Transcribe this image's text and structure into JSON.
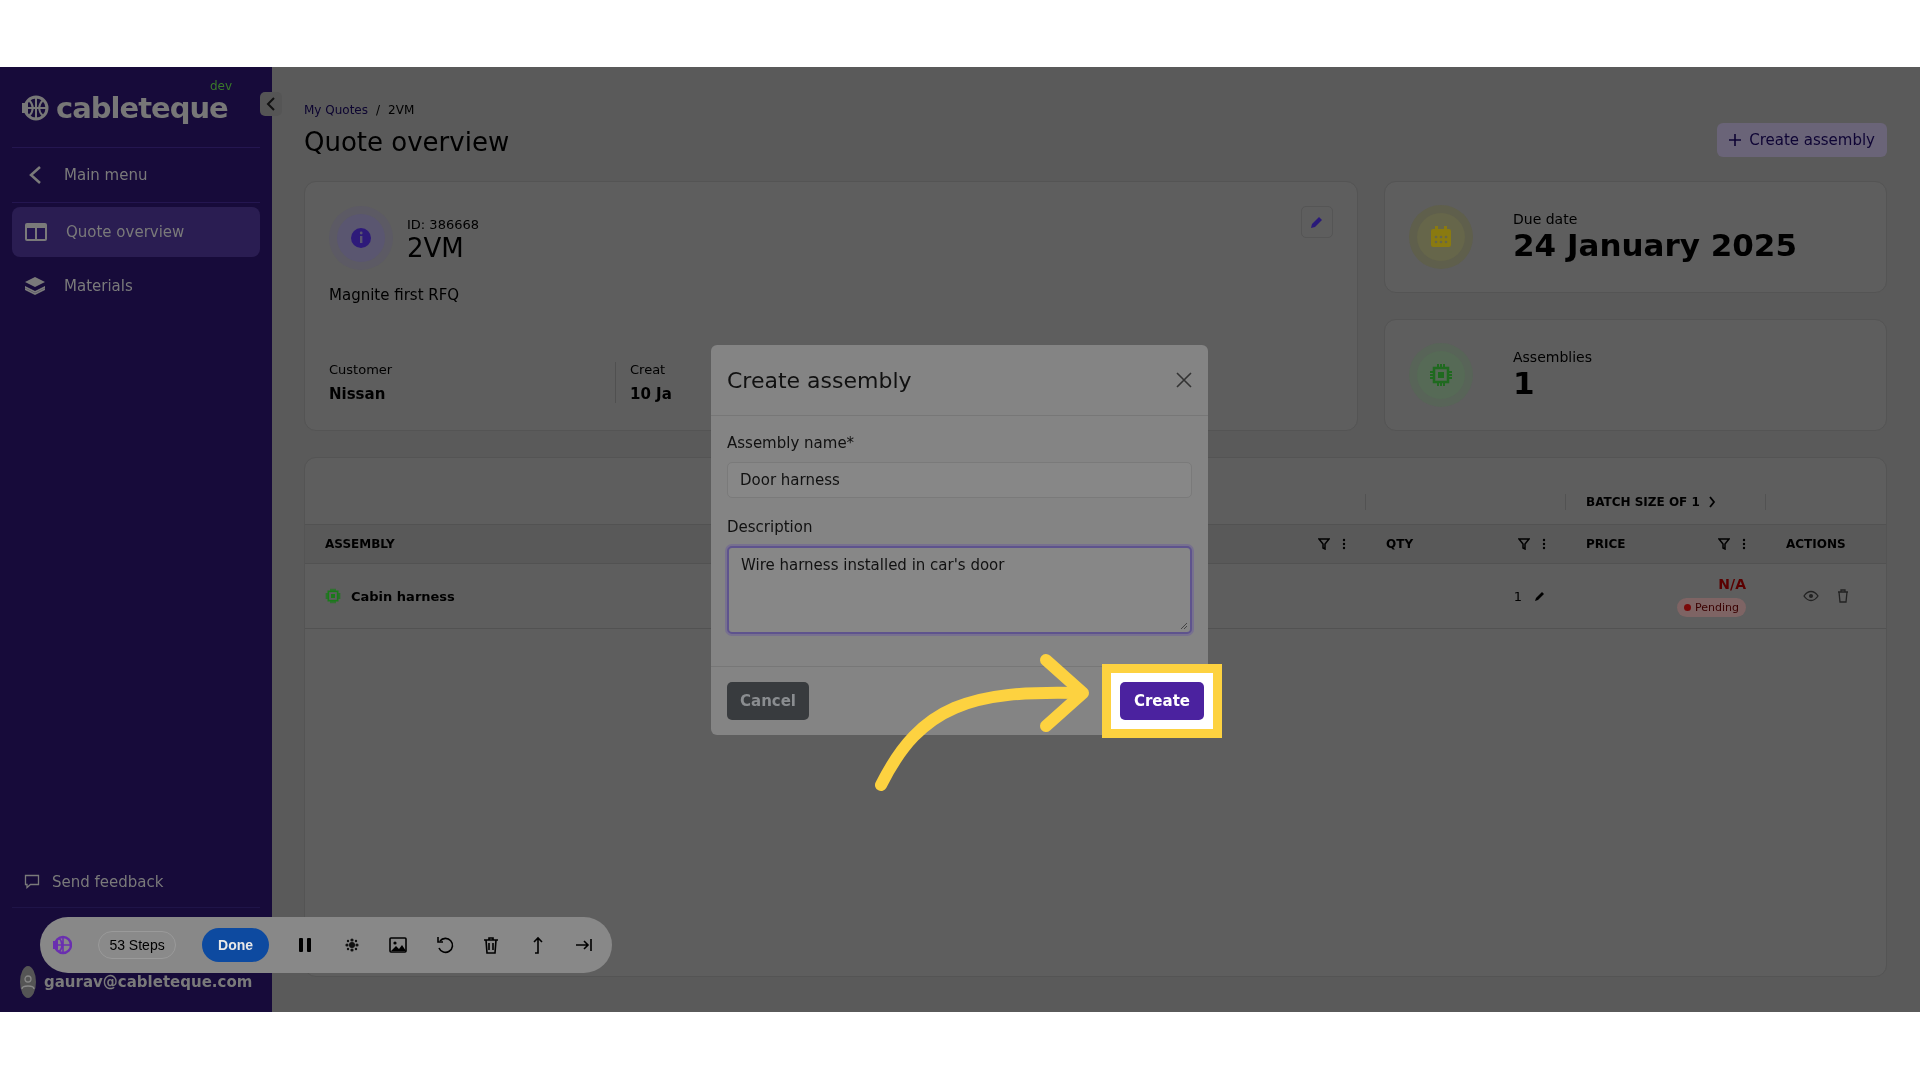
{
  "sidebar": {
    "logo": {
      "name": "cableteque",
      "badge": "dev"
    },
    "back_item": "Main menu",
    "items": [
      {
        "label": "Quote overview",
        "selected": true
      },
      {
        "label": "Materials",
        "selected": false
      }
    ],
    "feedback": "Send feedback",
    "user_email": "gaurav@cableteque.com"
  },
  "breadcrumb": {
    "links": [
      "My Quotes",
      "2VM"
    ],
    "separator": "/"
  },
  "page_title": "Quote overview",
  "create_button": "Create assembly",
  "quote_card": {
    "id": "ID: 386668",
    "name": "2VM",
    "description": "Magnite first RFQ",
    "fields": [
      {
        "label": "Customer",
        "value": "Nissan"
      },
      {
        "label": "Creat",
        "value": "10 Ja"
      }
    ]
  },
  "stat_cards": [
    {
      "kind": "calendar",
      "label": "Due date",
      "value": "24 January 2025"
    },
    {
      "kind": "chip",
      "label": "Assemblies",
      "value": "1"
    }
  ],
  "table": {
    "group_header": "BATCH SIZE OF 1",
    "columns": [
      {
        "label": "ASSEMBLY",
        "filter": true
      },
      {
        "label": "QTY",
        "filter": true
      },
      {
        "label": "PRICE",
        "filter": true
      },
      {
        "label": "ACTIONS",
        "filter": false
      }
    ],
    "rows": [
      {
        "assembly": "Cabin harness",
        "qty": "1",
        "price": "N/A",
        "status": "Pending"
      }
    ]
  },
  "dialog": {
    "title": "Create assembly",
    "fields": [
      {
        "kind": "input",
        "label": "Assembly name*",
        "value": "Door harness",
        "focused": false
      },
      {
        "kind": "textarea",
        "label": "Description",
        "value": "Wire harness installed in car's door",
        "focused": true
      }
    ],
    "buttons": [
      {
        "kind": "secondary",
        "label": "Cancel",
        "highlighted": false
      },
      {
        "kind": "primary",
        "label": "Create",
        "highlighted": true
      }
    ]
  },
  "recorder": {
    "steps": "53 Steps",
    "done": "Done"
  }
}
